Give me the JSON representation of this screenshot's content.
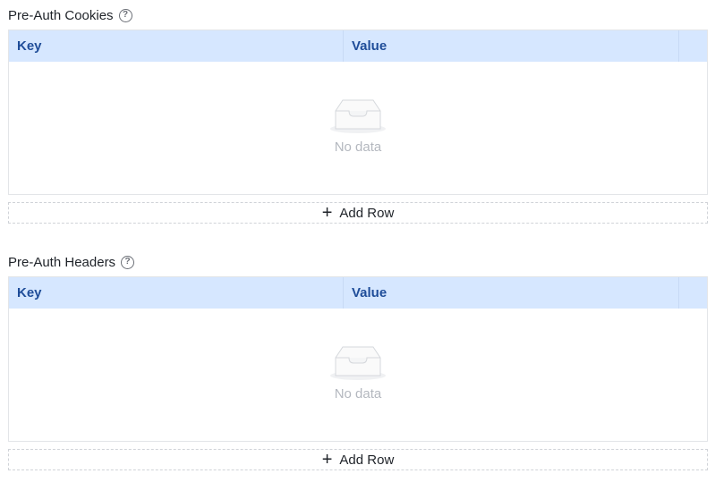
{
  "cookies": {
    "title": "Pre-Auth Cookies",
    "columns": {
      "key": "Key",
      "value": "Value"
    },
    "empty_text": "No data",
    "add_row_label": "Add Row"
  },
  "headers": {
    "title": "Pre-Auth Headers",
    "columns": {
      "key": "Key",
      "value": "Value"
    },
    "empty_text": "No data",
    "add_row_label": "Add Row"
  },
  "icons": {
    "help": "question-circle-icon",
    "empty": "empty-inbox-icon",
    "add": "plus-icon"
  },
  "colors": {
    "header_bg": "#d6e7ff",
    "header_text": "#1f4d99",
    "muted_text": "#b4b8bf"
  }
}
